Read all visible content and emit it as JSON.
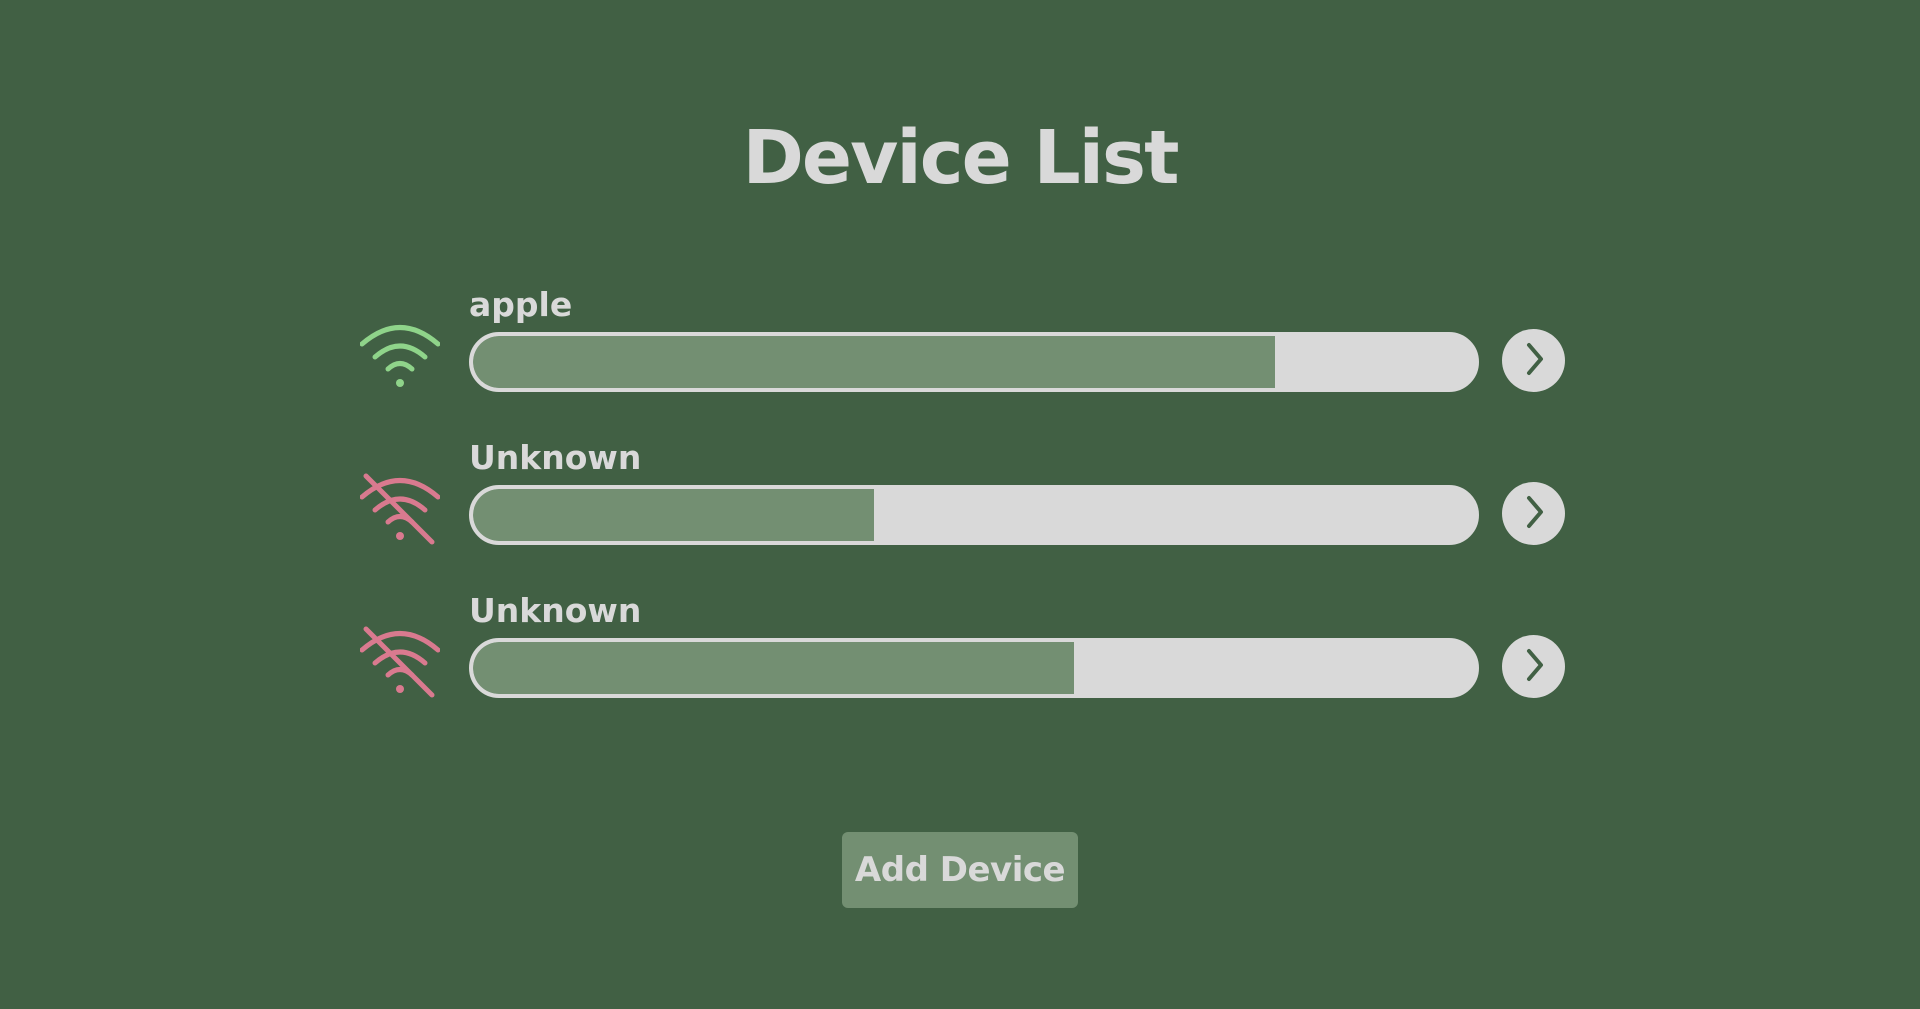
{
  "page": {
    "title": "Device List"
  },
  "colors": {
    "background": "#416044",
    "text": "#d9d9d9",
    "progress_fill": "#738f72",
    "progress_track": "#d9d9d9",
    "connected": "#8fd48a",
    "disconnected": "#d97a8f"
  },
  "devices": [
    {
      "name": "apple",
      "status": "connected",
      "icon": "wifi-icon",
      "progress": 0.8
    },
    {
      "name": "Unknown",
      "status": "disconnected",
      "icon": "wifi-off-icon",
      "progress": 0.4
    },
    {
      "name": "Unknown",
      "status": "disconnected",
      "icon": "wifi-off-icon",
      "progress": 0.6
    }
  ],
  "actions": {
    "open_icon": "chevron-right-icon",
    "add_device_label": "Add Device"
  }
}
